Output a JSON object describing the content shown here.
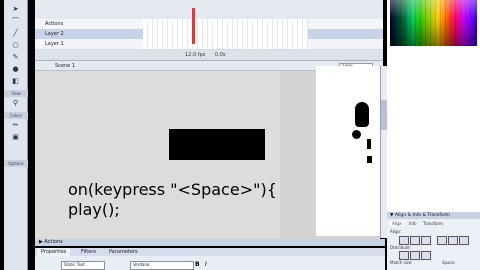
{
  "timeline": {
    "layers": [
      {
        "name": "Actions"
      },
      {
        "name": "Layer 2"
      },
      {
        "name": "Layer 1"
      }
    ],
    "status": {
      "fps": "12.0 fps",
      "time": "0.0s"
    }
  },
  "editbar": {
    "scene": "Scene 1",
    "zoom": "100%"
  },
  "stage": {
    "code_line1": "on(keypress \"<Space>\"){",
    "code_line2": "play();"
  },
  "panels": {
    "actions_title": "▶ Actions",
    "props_tabs": [
      "Properties",
      "Filters",
      "Parameters"
    ],
    "props_fields": {
      "text_type": "Static Text",
      "font": "Verdana"
    },
    "align_title": "▼ Align & Info & Transform",
    "align_tabs": [
      "Align",
      "Info",
      "Transform"
    ],
    "align_labels": [
      "Align:",
      "Distribute:",
      "Match size:",
      "Space:"
    ]
  },
  "tools": {
    "sections": [
      "View",
      "Colors",
      "Options"
    ]
  },
  "colors": {
    "stage_bg": "#dcdcdc",
    "tl_bg": "#eef1f6",
    "accent": "#c9d2e3",
    "playhead": "#e33333"
  }
}
